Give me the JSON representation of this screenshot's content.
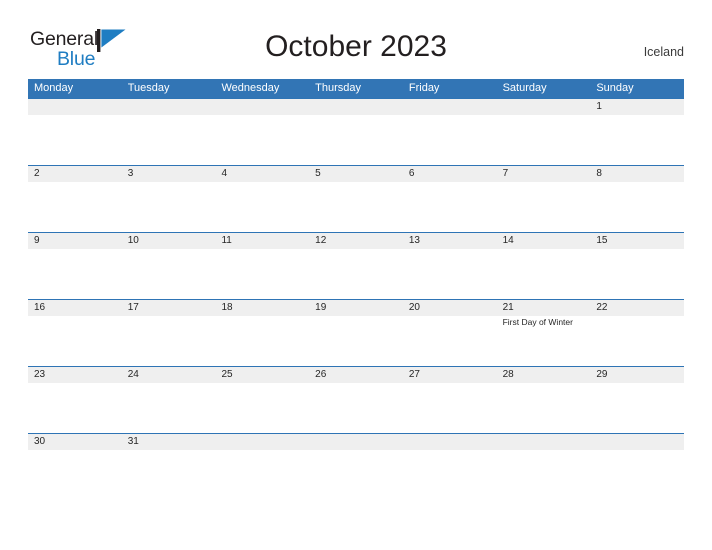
{
  "branding": {
    "logo_primary": "General",
    "logo_secondary": "Blue",
    "logo_icon": "flag-triangle-icon"
  },
  "header": {
    "title": "October 2023",
    "region": "Iceland"
  },
  "colors": {
    "header_blue": "#3275b5",
    "rule_blue": "#2e74b5",
    "date_band_gray": "#efefef",
    "logo_blue": "#1f7dc2",
    "text_dark": "#231f20"
  },
  "calendar": {
    "day_headers": [
      "Monday",
      "Tuesday",
      "Wednesday",
      "Thursday",
      "Friday",
      "Saturday",
      "Sunday"
    ],
    "weeks": [
      {
        "days": [
          {
            "date": "",
            "event": ""
          },
          {
            "date": "",
            "event": ""
          },
          {
            "date": "",
            "event": ""
          },
          {
            "date": "",
            "event": ""
          },
          {
            "date": "",
            "event": ""
          },
          {
            "date": "",
            "event": ""
          },
          {
            "date": "1",
            "event": ""
          }
        ]
      },
      {
        "days": [
          {
            "date": "2",
            "event": ""
          },
          {
            "date": "3",
            "event": ""
          },
          {
            "date": "4",
            "event": ""
          },
          {
            "date": "5",
            "event": ""
          },
          {
            "date": "6",
            "event": ""
          },
          {
            "date": "7",
            "event": ""
          },
          {
            "date": "8",
            "event": ""
          }
        ]
      },
      {
        "days": [
          {
            "date": "9",
            "event": ""
          },
          {
            "date": "10",
            "event": ""
          },
          {
            "date": "11",
            "event": ""
          },
          {
            "date": "12",
            "event": ""
          },
          {
            "date": "13",
            "event": ""
          },
          {
            "date": "14",
            "event": ""
          },
          {
            "date": "15",
            "event": ""
          }
        ]
      },
      {
        "days": [
          {
            "date": "16",
            "event": ""
          },
          {
            "date": "17",
            "event": ""
          },
          {
            "date": "18",
            "event": ""
          },
          {
            "date": "19",
            "event": ""
          },
          {
            "date": "20",
            "event": ""
          },
          {
            "date": "21",
            "event": "First Day of Winter"
          },
          {
            "date": "22",
            "event": ""
          }
        ]
      },
      {
        "days": [
          {
            "date": "23",
            "event": ""
          },
          {
            "date": "24",
            "event": ""
          },
          {
            "date": "25",
            "event": ""
          },
          {
            "date": "26",
            "event": ""
          },
          {
            "date": "27",
            "event": ""
          },
          {
            "date": "28",
            "event": ""
          },
          {
            "date": "29",
            "event": ""
          }
        ]
      },
      {
        "days": [
          {
            "date": "30",
            "event": ""
          },
          {
            "date": "31",
            "event": ""
          },
          {
            "date": "",
            "event": ""
          },
          {
            "date": "",
            "event": ""
          },
          {
            "date": "",
            "event": ""
          },
          {
            "date": "",
            "event": ""
          },
          {
            "date": "",
            "event": ""
          }
        ]
      }
    ]
  }
}
